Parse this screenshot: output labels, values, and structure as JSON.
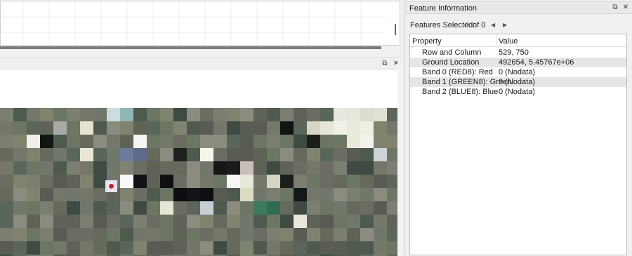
{
  "map_view": {
    "float_glyph": "⧉",
    "close_glyph": "✕"
  },
  "feature_info": {
    "title": "Feature Information",
    "float_glyph": "⧉",
    "close_glyph": "✕",
    "features_selected_label": "Features Selected:",
    "selected_index": "0",
    "of_text": "of 0",
    "prev_glyph": "◀",
    "next_glyph": "▶",
    "columns": [
      "Property",
      "Value"
    ],
    "rows": [
      {
        "property": "Row and Column",
        "value": "529, 750"
      },
      {
        "property": "Ground Location",
        "value": "492654, 5.45767e+06"
      },
      {
        "property": "Band 0 (RED8): Red",
        "value": "0 (Nodata)"
      },
      {
        "property": "Band 1 (GREEN8): Green",
        "value": "0 (Nodata)"
      },
      {
        "property": "Band 2 (BLUE8): Blue",
        "value": "0 (Nodata)"
      }
    ]
  }
}
